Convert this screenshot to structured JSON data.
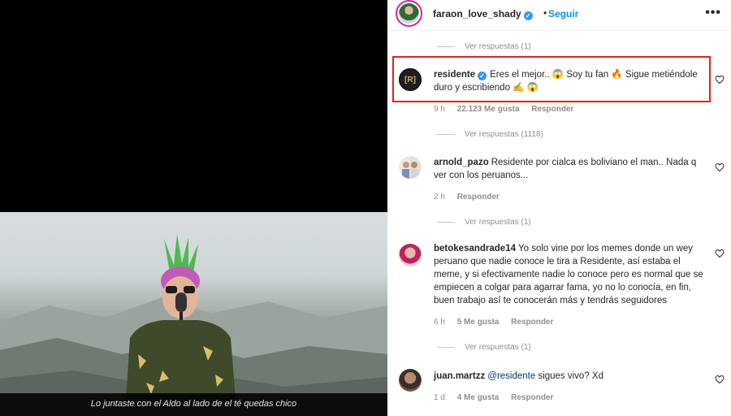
{
  "video": {
    "subtitle": "Lo juntaste con el Aldo al lado de el té quedas chico"
  },
  "header": {
    "username": "faraon_love_shady",
    "follow_label": "Seguir",
    "dot": "•",
    "more": "•••"
  },
  "replies": [
    "Ver respuestas (1)",
    "Ver respuestas (1118)",
    "Ver respuestas (1)",
    "Ver respuestas (1)"
  ],
  "comments": [
    {
      "user": "residente",
      "verified": true,
      "text": "Eres el mejor.. 😱 Soy tu fan 🔥 Sigue metiéndole duro y escribiendo ✍️ 😱",
      "time": "9 h",
      "likes": "22.123 Me gusta",
      "reply": "Responder",
      "avatar_letter": "[R]"
    },
    {
      "user": "arnold_pazo",
      "text": "Residente por cialca es boliviano el man.. Nada q ver con los peruanos...",
      "time": "2 h",
      "reply": "Responder"
    },
    {
      "user": "betokesandrade14",
      "text": "Yo solo vine por los memes donde un wey peruano que nadie conoce le tira a Residente, así estaba el meme, y si efectivamente nadie lo conoce pero es normal que se empiecen a colgar para agarrar fama, yo no lo conocía, en fin, buen trabajo así te conocerán más y tendrás seguidores",
      "time": "6 h",
      "likes": "5 Me gusta",
      "reply": "Responder"
    },
    {
      "user": "juan.martzz",
      "mention": "@residente",
      "text": " sigues vivo? Xd",
      "time": "1 d",
      "likes": "4 Me gusta",
      "reply": "Responder"
    }
  ],
  "colors": {
    "accent": "#0095f6",
    "verified": "#3897f0",
    "highlight": "#e0202a",
    "muted": "#8e8e8e"
  }
}
